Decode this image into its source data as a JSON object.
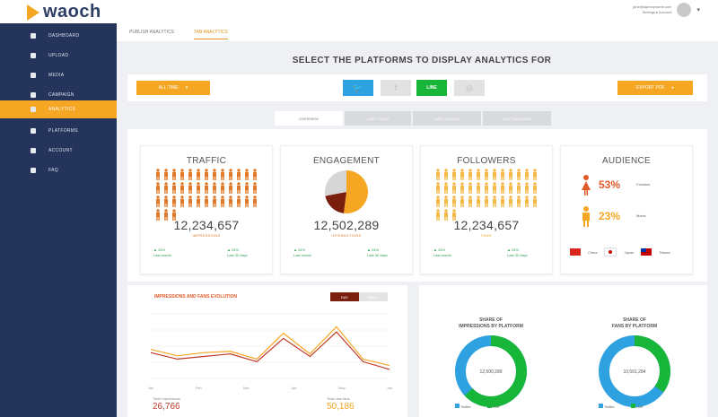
{
  "app": {
    "name": "waoch"
  },
  "user": {
    "line1": "jane@agencyname.com",
    "line2": "Settings ▸ Account"
  },
  "sidebar": {
    "items": [
      {
        "label": "DASHBOARD",
        "active": false
      },
      {
        "label": "UPLOAD",
        "active": false
      },
      {
        "label": "MEDIA",
        "active": false
      },
      {
        "label": "CAMPAIGN",
        "active": false
      },
      {
        "label": "ANALYTICS",
        "active": true
      },
      {
        "label": "PLATFORMS",
        "active": false
      },
      {
        "label": "ACCOUNT",
        "active": false
      },
      {
        "label": "FAQ",
        "active": false
      }
    ]
  },
  "subtabs": [
    {
      "label": "PUBLISH ANALYTICS",
      "active": false
    },
    {
      "label": "TAB ANALYTICS",
      "active": true
    }
  ],
  "page_title": "SELECT THE PLATFORMS TO DISPLAY ANALYTICS FOR",
  "selector": {
    "left_button": "ALL TIME",
    "right_button": "EXPORT PDF",
    "platforms": [
      {
        "name": "twitter",
        "glyph": "🐦",
        "enabled": true,
        "color": "#2ea1e0"
      },
      {
        "name": "facebook",
        "glyph": "f",
        "enabled": false,
        "color": "#d9d9d9"
      },
      {
        "name": "line",
        "glyph": "LINE",
        "enabled": true,
        "color": "#17b638"
      },
      {
        "name": "instagram",
        "glyph": "◎",
        "enabled": false,
        "color": "#d9d9d9"
      }
    ]
  },
  "period_tabs": [
    "OVERVIEW",
    "LAST 7 DAYS",
    "LAST 30 DAYS",
    "CUSTOM RANGE"
  ],
  "cards": {
    "traffic": {
      "title": "TRAFFIC",
      "value": "12,234,657",
      "sub": "IMPRESSIONS",
      "left_stat": "▲ 24%\nLast month",
      "right_stat": "▲ 24%\nLast 30 days"
    },
    "engagement": {
      "title": "ENGAGEMENT",
      "value": "12,502,289",
      "sub": "INTERACTIONS",
      "left_stat": "▲ 24%\nLast month",
      "right_stat": "▲ 24%\nLast 30 days",
      "pie": [
        {
          "label": "Orange",
          "pct": 52,
          "color": "#f5a623"
        },
        {
          "label": "Maroon",
          "pct": 20,
          "color": "#7a1f0e"
        },
        {
          "label": "Grey",
          "pct": 28,
          "color": "#d6d6d6"
        }
      ]
    },
    "followers": {
      "title": "FOLLOWERS",
      "value": "12,234,657",
      "sub": "FANS",
      "left_stat": "▲ 24%\nLast month",
      "right_stat": "▲ 24%\nLast 30 days"
    },
    "audience": {
      "title": "AUDIENCE",
      "female_pct": "53%",
      "female_label": "Females",
      "male_pct": "23%",
      "male_label": "Males",
      "countries": [
        "China",
        "Japan",
        "Taiwan"
      ]
    }
  },
  "impressions_chart": {
    "title": "IMPRESSIONS AND FANS EVOLUTION",
    "toggle_active": "DAY",
    "toggle_inactive": "WEEK",
    "left_label": "Total impressions",
    "left_value": "26,766",
    "right_label": "Total new fans",
    "right_value": "50,186",
    "x_labels": [
      "Jan",
      "Feb",
      "Mar",
      "Apr",
      "May",
      "Jun"
    ],
    "series_orange": [
      55,
      65,
      60,
      58,
      70,
      30,
      62,
      20,
      70,
      80
    ],
    "series_red": [
      60,
      70,
      66,
      62,
      74,
      38,
      66,
      28,
      74,
      86
    ]
  },
  "donuts": [
    {
      "title": "SHARE OF\nIMPRESSIONS BY PLATFORM",
      "center": "12,500,289",
      "green_pct": 63,
      "blue_pct": 37,
      "legend_a": "Twitter",
      "legend_b": "Line"
    },
    {
      "title": "SHARE OF\nFANS BY PLATFORM",
      "center": "10,501,284",
      "green_pct": 35,
      "blue_pct": 65,
      "legend_a": "Twitter",
      "legend_b": "Line"
    }
  ]
}
